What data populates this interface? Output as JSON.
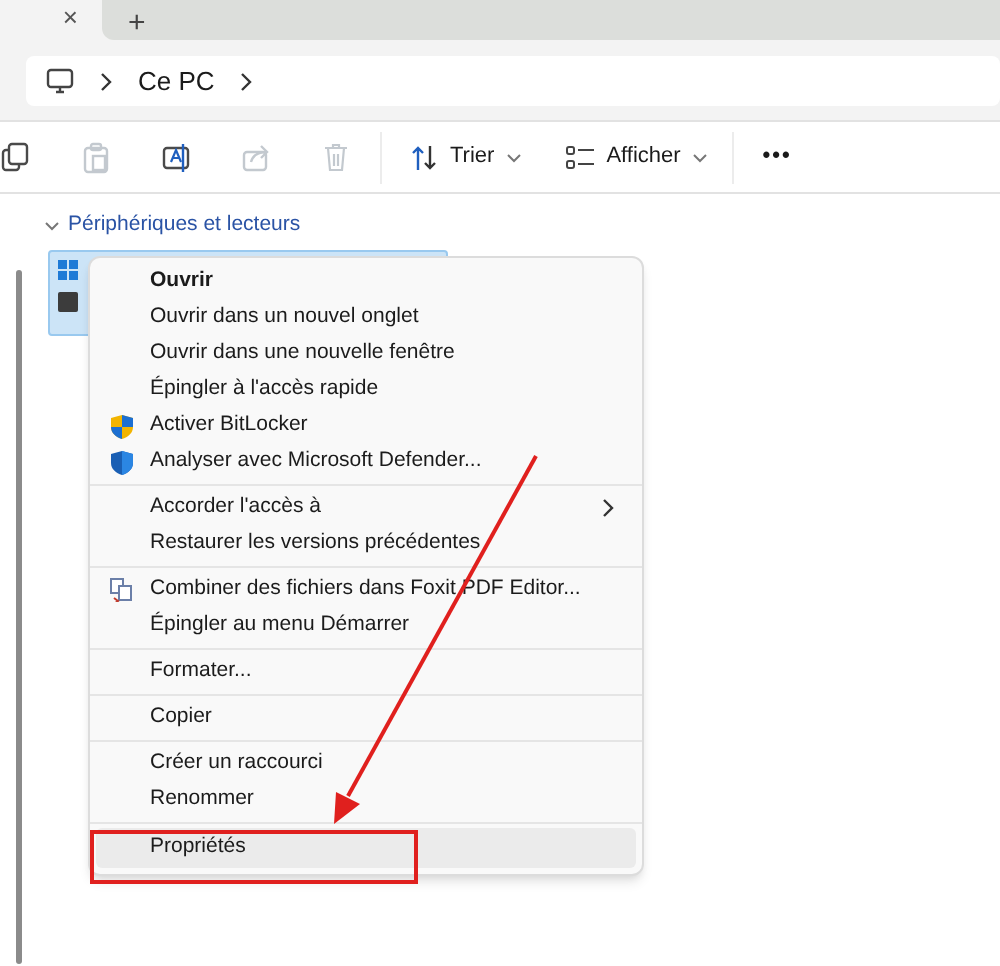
{
  "tab_bar": {
    "close_tab": "×",
    "new_tab": "+"
  },
  "address_bar": {
    "crumbs": [
      "Ce PC"
    ]
  },
  "toolbar": {
    "icon_buttons": [
      {
        "kind": "copy",
        "disabled": false
      },
      {
        "kind": "paste",
        "disabled": true
      },
      {
        "kind": "rename",
        "disabled": false
      },
      {
        "kind": "share",
        "disabled": true
      },
      {
        "kind": "delete",
        "disabled": true
      }
    ],
    "menus": [
      {
        "kind": "sort",
        "label": "Trier"
      },
      {
        "kind": "view",
        "label": "Afficher"
      }
    ],
    "more": "•••"
  },
  "section": {
    "title": "Périphériques et lecteurs",
    "expanded": true
  },
  "drive": {
    "selected": true
  },
  "context_menu": {
    "groups": [
      {
        "items": [
          {
            "label": "Ouvrir",
            "kind": "plain",
            "default": true,
            "submenu": false,
            "selected": false
          },
          {
            "label": "Ouvrir dans un nouvel onglet",
            "kind": "plain",
            "default": false,
            "submenu": false,
            "selected": false
          },
          {
            "label": "Ouvrir dans une nouvelle fenêtre",
            "kind": "plain",
            "default": false,
            "submenu": false,
            "selected": false
          },
          {
            "label": "Épingler à l'accès rapide",
            "kind": "plain",
            "default": false,
            "submenu": false,
            "selected": false
          },
          {
            "label": "Activer BitLocker",
            "kind": "shield",
            "default": false,
            "submenu": false,
            "selected": false
          },
          {
            "label": "Analyser avec Microsoft Defender...",
            "kind": "defender",
            "default": false,
            "submenu": false,
            "selected": false
          }
        ]
      },
      {
        "items": [
          {
            "label": "Accorder l'accès à",
            "kind": "plain",
            "default": false,
            "submenu": true,
            "selected": false
          },
          {
            "label": "Restaurer les versions précédentes",
            "kind": "plain",
            "default": false,
            "submenu": false,
            "selected": false
          }
        ]
      },
      {
        "items": [
          {
            "label": "Combiner des fichiers dans Foxit PDF Editor...",
            "kind": "combine",
            "default": false,
            "submenu": false,
            "selected": false
          },
          {
            "label": "Épingler au menu Démarrer",
            "kind": "plain",
            "default": false,
            "submenu": false,
            "selected": false
          }
        ]
      },
      {
        "items": [
          {
            "label": "Formater...",
            "kind": "plain",
            "default": false,
            "submenu": false,
            "selected": false
          }
        ]
      },
      {
        "items": [
          {
            "label": "Copier",
            "kind": "plain",
            "default": false,
            "submenu": false,
            "selected": false
          }
        ]
      },
      {
        "items": [
          {
            "label": "Créer un raccourci",
            "kind": "plain",
            "default": false,
            "submenu": false,
            "selected": false
          },
          {
            "label": "Renommer",
            "kind": "plain",
            "default": false,
            "submenu": false,
            "selected": false
          }
        ]
      },
      {
        "items": [
          {
            "label": "Propriétés",
            "kind": "plain",
            "default": false,
            "submenu": false,
            "selected": true
          }
        ]
      }
    ]
  }
}
